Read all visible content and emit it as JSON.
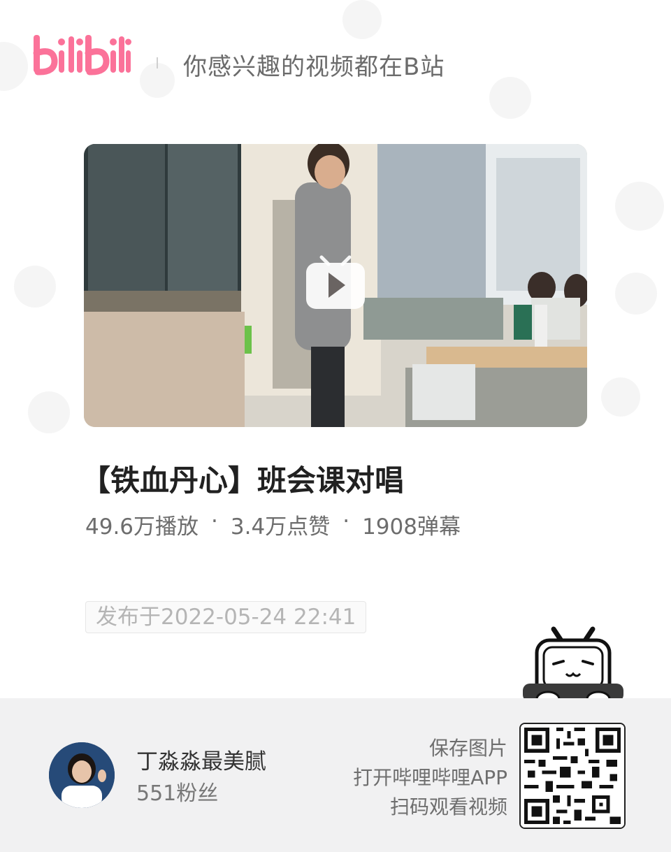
{
  "header": {
    "logo_text": "bilibili",
    "slogan": "你感兴趣的视频都在B站"
  },
  "video": {
    "title": "【铁血丹心】班会课对唱",
    "stats": {
      "plays": "49.6万播放",
      "likes": "3.4万点赞",
      "danmaku": "1908弹幕"
    },
    "publish": "发布于2022-05-24 22:41"
  },
  "uploader": {
    "name": "丁淼淼最美腻",
    "fans": "551粉丝"
  },
  "cta": {
    "line1": "保存图片",
    "line2": "打开哔哩哔哩APP",
    "line3": "扫码观看视频"
  },
  "colors": {
    "brand_pink": "#fb7299",
    "footer_bg": "#f1f1f2"
  },
  "icons": [
    "bilibili-logo",
    "play-icon",
    "tv-mascot-icon",
    "qr-code"
  ]
}
